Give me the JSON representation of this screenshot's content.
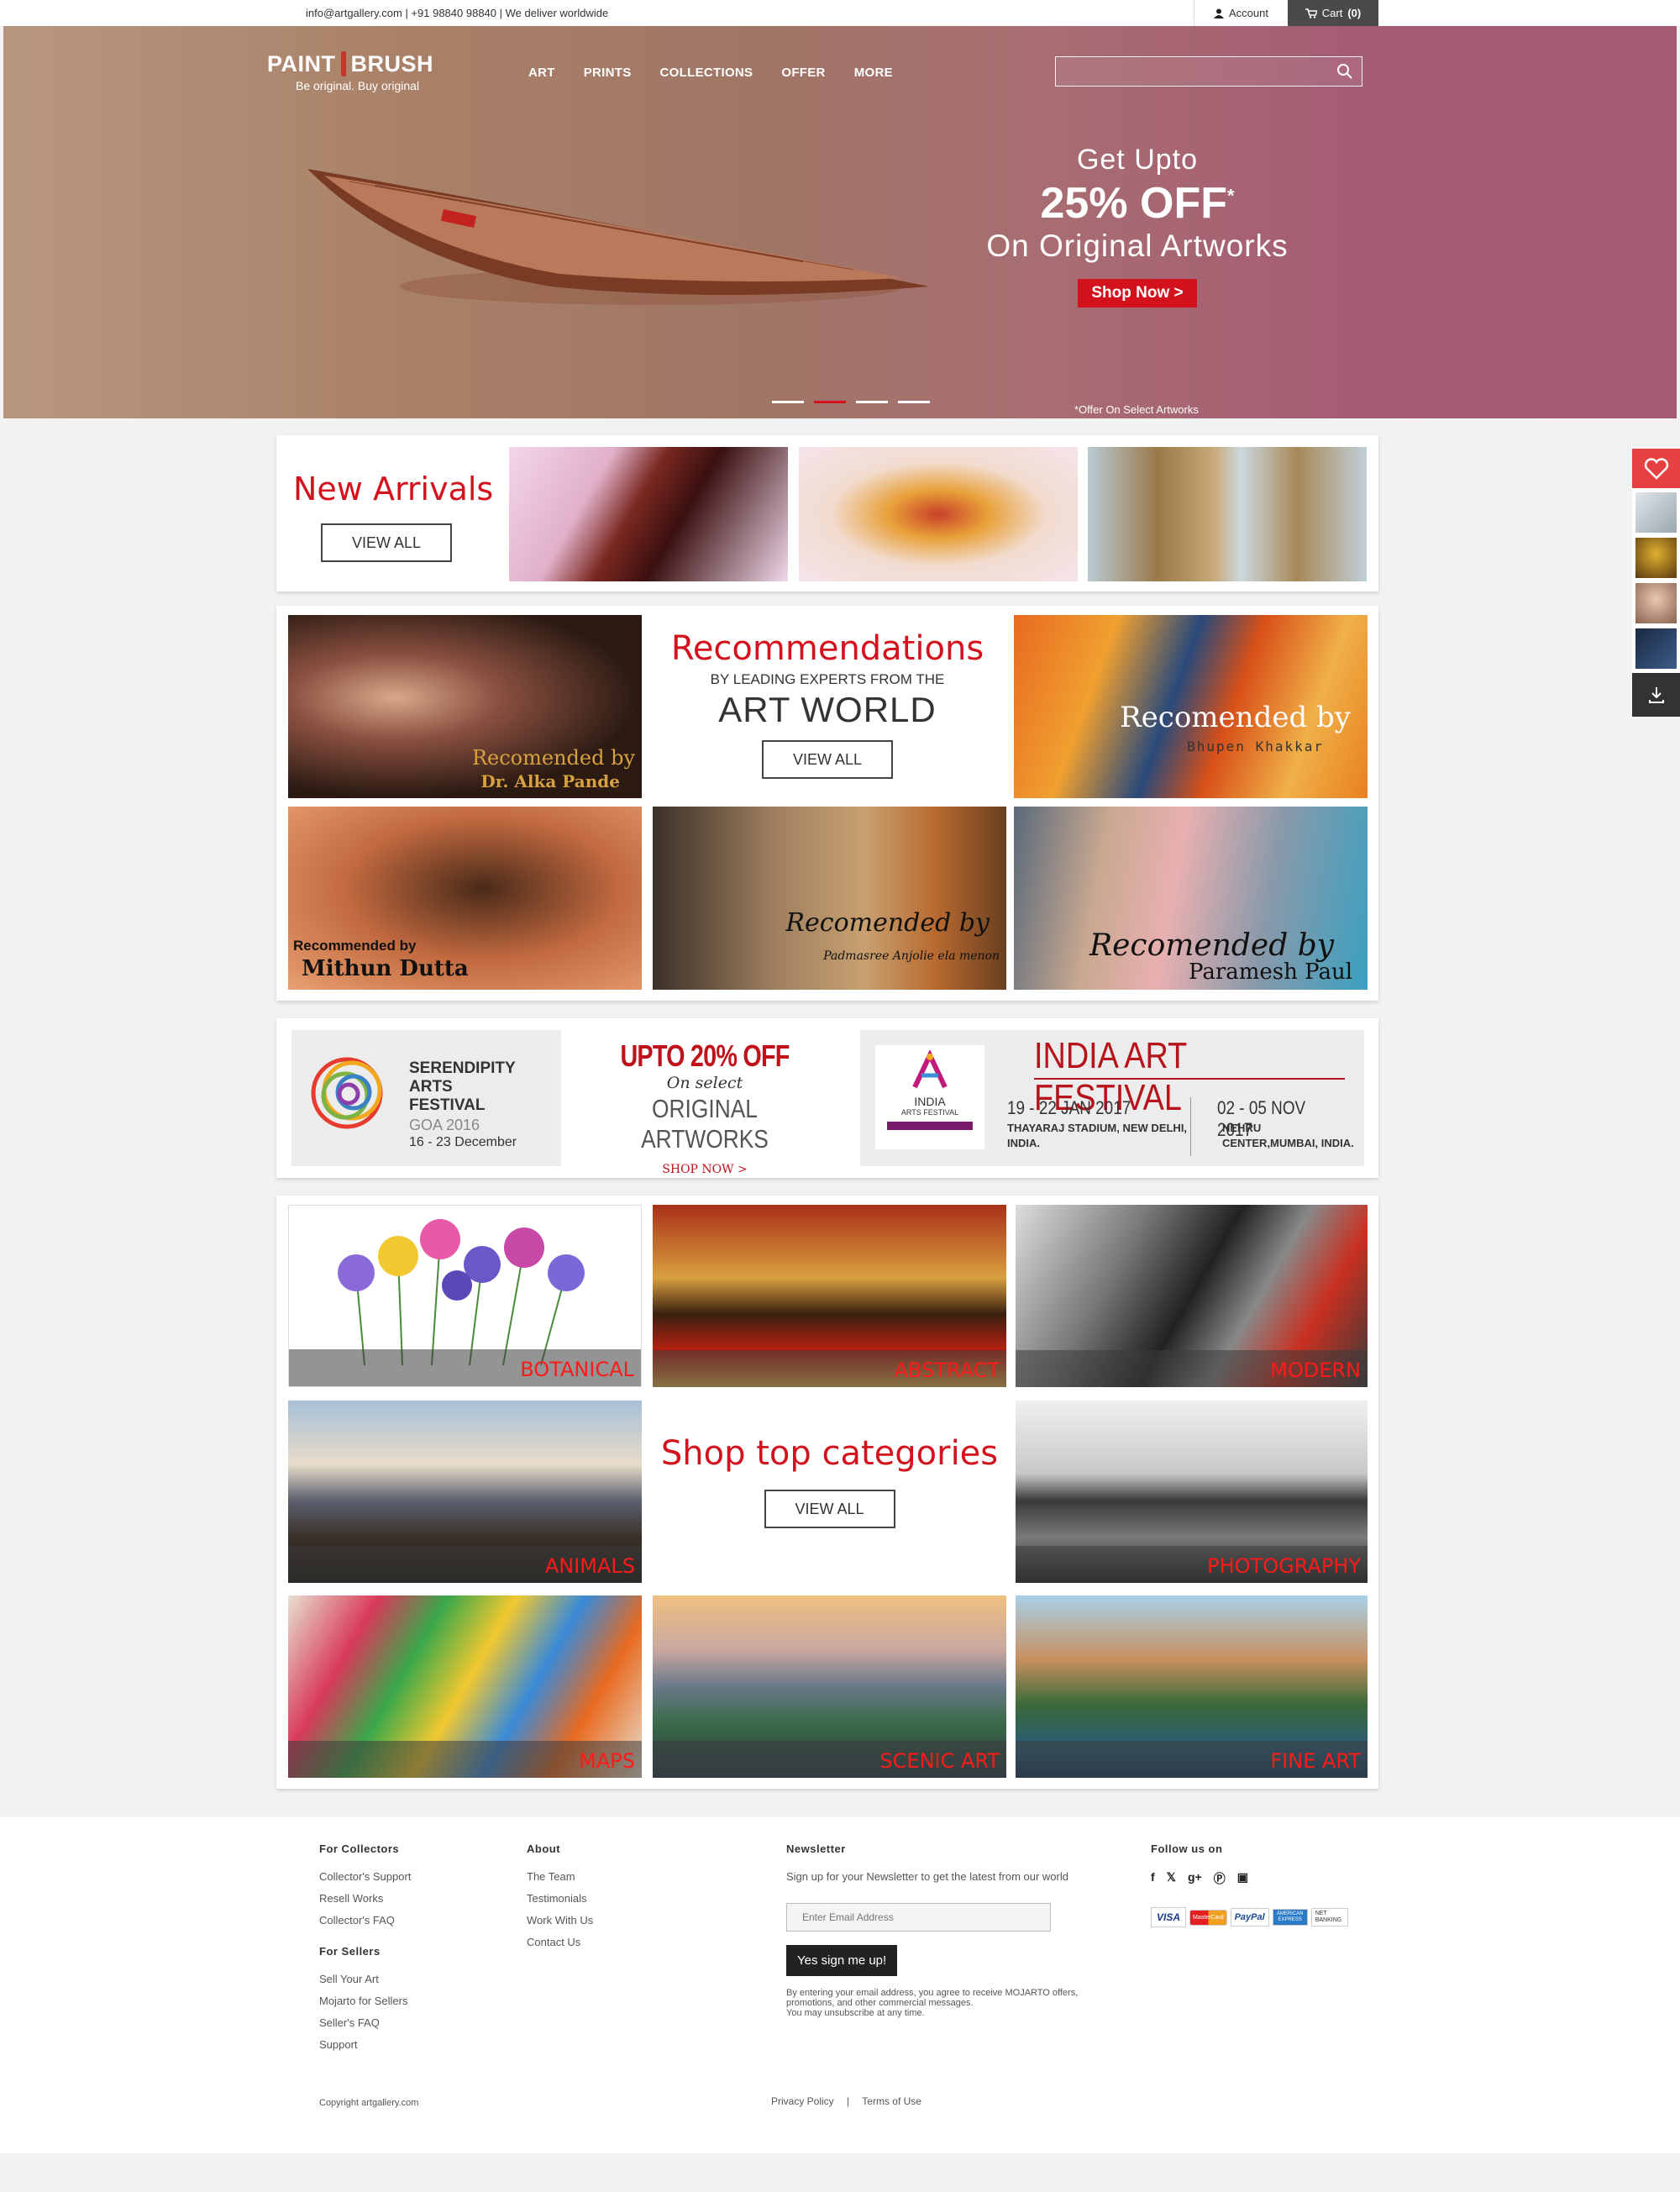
{
  "topbar": {
    "contact": "info@artgallery.com | +91 98840 98840 | We deliver worldwide",
    "account_label": "Account",
    "cart_label": "Cart",
    "cart_count": "(0)"
  },
  "brand": {
    "name_left": "PAINT",
    "name_right": "BRUSH",
    "tagline": "Be original. Buy original"
  },
  "nav": {
    "items": [
      "ART",
      "PRINTS",
      "COLLECTIONS",
      "OFFER",
      "MORE"
    ]
  },
  "hero": {
    "line1": "Get Upto",
    "line2": "25% OFF",
    "line2_sup": "*",
    "line3": "On Original Artworks",
    "cta": "Shop Now >",
    "note": "*Offer On Select Artworks",
    "slides_total": 4,
    "active_slide": 2
  },
  "new_arrivals": {
    "title": "New Arrivals",
    "button": "VIEW ALL"
  },
  "recommendations": {
    "title": "Recommendations",
    "subtitle": "BY LEADING EXPERTS FROM THE",
    "subtitle2": "ART WORLD",
    "button": "VIEW ALL",
    "items": [
      {
        "line1": "Recomended by",
        "line2": "Dr. Alka Pande"
      },
      {
        "line1": "Recomended by",
        "line2": "Bhupen Khakkar"
      },
      {
        "line1": "Recommended by",
        "line2": "Mithun Dutta"
      },
      {
        "line1": "Recomended by",
        "line2": "Padmasree Anjolie ela menon"
      },
      {
        "line1": "Recomended by",
        "line2": "Paramesh Paul"
      }
    ]
  },
  "banners": {
    "serendipity": {
      "l1": "SERENDIPITY",
      "l2": "ARTS",
      "l3": "FESTIVAL",
      "l4": "GOA 2016",
      "l5": "16 - 23 December"
    },
    "offer": {
      "l1": "UPTO 20% OFF",
      "l2": "On select",
      "l3": "ORIGINAL ARTWORKS",
      "l4": "SHOP NOW >"
    },
    "festival": {
      "title": "INDIA ART FESTIVAL",
      "logo_text": "INDIA",
      "logo_sub": "ARTS FESTIVAL",
      "d1": "19 - 22 JAN 2017",
      "v1": "THAYARAJ STADIUM, NEW DELHI, INDIA.",
      "d2": "02 - 05 NOV 2017",
      "v2": "NEHRU CENTER,MUMBAI, INDIA."
    }
  },
  "categories": {
    "title": "Shop top categories",
    "button": "VIEW ALL",
    "items": [
      "BOTANICAL",
      "ABSTRACT",
      "MODERN",
      "ANIMALS",
      "PHOTOGRAPHY",
      "MAPS",
      "SCENIC ART",
      "FINE ART"
    ]
  },
  "footer": {
    "collectors_title": "For Collectors",
    "collectors": [
      "Collector's Support",
      "Resell Works",
      "Collector's FAQ"
    ],
    "sellers_title": "For Sellers",
    "sellers": [
      "Sell Your Art",
      "Mojarto for Sellers",
      "Seller's FAQ",
      "Support"
    ],
    "about_title": "About",
    "about": [
      "The Team",
      "Testimonials",
      "Work With Us",
      "Contact Us"
    ],
    "newsletter_title": "Newsletter",
    "newsletter_text": "Sign up for your Newsletter to get the latest from our world",
    "email_placeholder": "Enter Email Address",
    "signup": "Yes sign me up!",
    "disclaimer1": "By entering your email address, you agree to receive MOJARTO offers,",
    "disclaimer2": "promotions, and other commercial messages.",
    "disclaimer3": "You may unsubscribe at any time.",
    "follow_title": "Follow us on",
    "payments": [
      "VISA",
      "MasterCard",
      "PayPal",
      "AMERICAN EXPRESS",
      "NET BANKING"
    ],
    "copyright": "Copyright artgallery.com",
    "privacy": "Privacy Policy",
    "separator": "|",
    "terms": "Terms of Use"
  },
  "colors": {
    "accent": "#d3121d",
    "dark": "#333333",
    "hero_pink": "#a45a72"
  }
}
